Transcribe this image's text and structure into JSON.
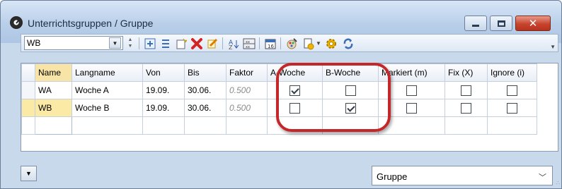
{
  "window": {
    "title": "Unterrichtsgruppen / Gruppe",
    "minimize_icon": "minimize-icon",
    "maximize_icon": "maximize-icon",
    "close_icon": "close-icon",
    "close_glyph": "✕"
  },
  "toolbar": {
    "selector_value": "WB",
    "icons": [
      "add-row-icon",
      "list-icon",
      "new-item-icon",
      "delete-icon",
      "edit-icon",
      "sort-icon",
      "grid-icon",
      "calendar-icon",
      "paint-icon",
      "print-icon",
      "settings-icon",
      "refresh-icon"
    ]
  },
  "grid": {
    "columns": [
      "Name",
      "Langname",
      "Von",
      "Bis",
      "Faktor",
      "A-Woche",
      "B-Woche",
      "Markiert (m)",
      "Fix (X)",
      "Ignore (i)"
    ],
    "rows": [
      {
        "name": "WA",
        "langname": "Woche A",
        "von": "19.09.",
        "bis": "30.06.",
        "faktor": "0.500",
        "a_woche": true,
        "b_woche": false,
        "markiert": false,
        "fix": false,
        "ignore": false
      },
      {
        "name": "WB",
        "langname": "Woche B",
        "von": "19.09.",
        "bis": "30.06.",
        "faktor": "0.500",
        "a_woche": false,
        "b_woche": true,
        "markiert": false,
        "fix": false,
        "ignore": false
      }
    ]
  },
  "footer": {
    "view_select_value": "Gruppe"
  },
  "colors": {
    "highlight": "#c4272a",
    "selected_row": "#fbeaa5"
  }
}
